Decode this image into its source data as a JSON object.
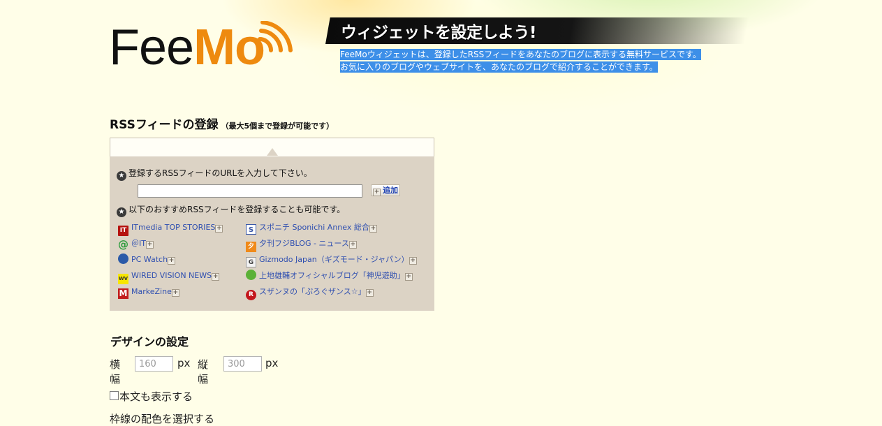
{
  "header": {
    "logo_text_fee": "Fee",
    "logo_text_mo": "Mo",
    "banner_title": "ウィジェットを設定しよう!",
    "intro_line1": "FeeMoウィジェットは、登録したRSSフィードをあなたのブログに表示する無料サービスです。",
    "intro_line2": "お気に入りのブログやウェブサイトを、あなたのブログで紹介することができます。"
  },
  "rss_section": {
    "title": "RSSフィードの登録",
    "subtitle": "（最大5個まで登録が可能です）",
    "instruction_url": "登録するRSSフィードのURLを入力して下さい。",
    "url_value": "",
    "add_label": "追加",
    "instruction_recommended": "以下のおすすめRSSフィードを登録することも可能です。",
    "plus_glyph": "+",
    "star_glyph": "★",
    "feeds_left": [
      {
        "label": "ITmedia TOP STORIES",
        "icon": "itmedia-icon",
        "glyph": "IT"
      },
      {
        "label": "＠IT",
        "icon": "atmark-it-icon",
        "glyph": "@"
      },
      {
        "label": "PC Watch",
        "icon": "pc-watch-icon",
        "glyph": ""
      },
      {
        "label": "WIRED VISION NEWS",
        "icon": "wired-vision-icon",
        "glyph": "WV"
      },
      {
        "label": "MarkeZine",
        "icon": "markezine-icon",
        "glyph": "M"
      }
    ],
    "feeds_right": [
      {
        "label": "スポニチ Sponichi Annex 総合",
        "icon": "sponichi-icon",
        "glyph": "S"
      },
      {
        "label": "夕刊フジBLOG - ニュース",
        "icon": "yukan-fuji-icon",
        "glyph": "夕"
      },
      {
        "label": "Gizmodo Japan（ギズモード・ジャパン）",
        "icon": "gizmodo-icon",
        "glyph": "G"
      },
      {
        "label": "上地雄輔オフィシャルブログ「神児遊助」",
        "icon": "kamiji-clover-icon",
        "glyph": ""
      },
      {
        "label": "スザンヌの「ぷろぐザンス☆」",
        "icon": "suzanne-icon",
        "glyph": "R"
      }
    ]
  },
  "design_section": {
    "title": "デザインの設定",
    "width_label": "横幅",
    "width_value": "160",
    "height_label": "縦幅",
    "height_value": "300",
    "unit": "px",
    "show_body_label": "本文も表示する",
    "next_label_partial": "枠線の配色を選択する"
  },
  "colors": {
    "background": "#fffee8",
    "logo_orange": "#ee8a0f",
    "panel": "#dcd3c5",
    "link": "#2f4fb0",
    "selection": "#3d8fe8"
  }
}
